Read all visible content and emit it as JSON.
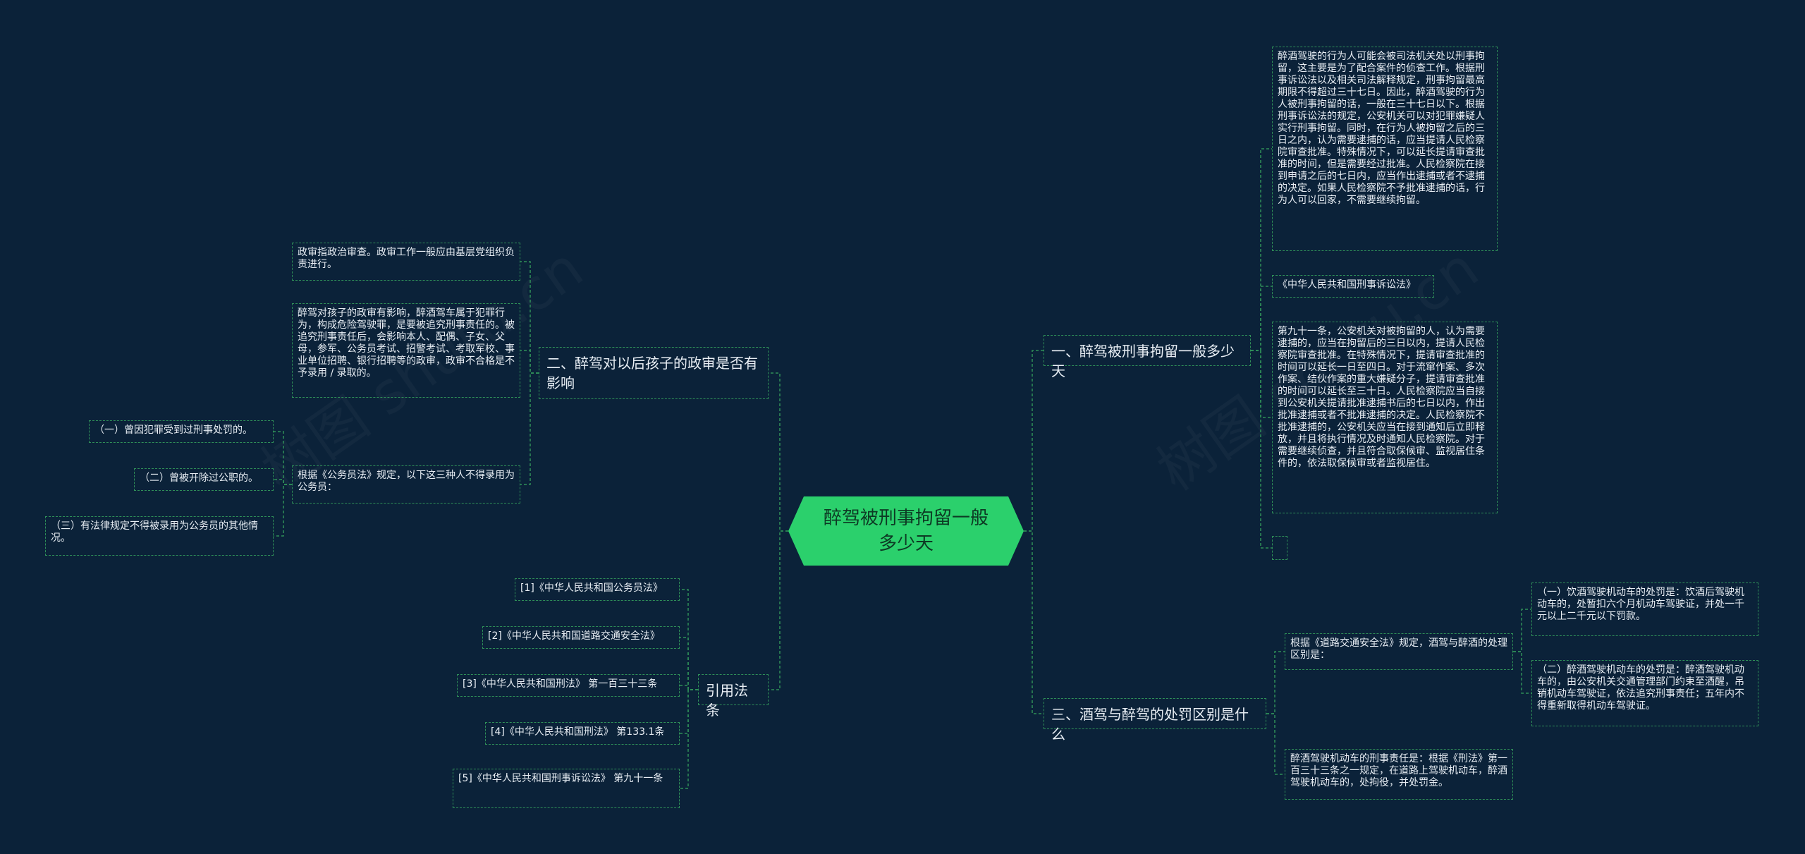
{
  "watermarks": [
    "树图 shutu.cn",
    "树图 shutu.cn"
  ],
  "root": "醉驾被刑事拘留一般多少天",
  "right": {
    "b1": {
      "title": "一、醉驾被刑事拘留一般多少天",
      "leaf1": "醉酒驾驶的行为人可能会被司法机关处以刑事拘留，这主要是为了配合案件的侦查工作。根据刑事诉讼法以及相关司法解释规定，刑事拘留最高期限不得超过三十七日。因此，醉酒驾驶的行为人被刑事拘留的话，一般在三十七日以下。根据刑事诉讼法的规定，公安机关可以对犯罪嫌疑人实行刑事拘留。同时，在行为人被拘留之后的三日之内，认为需要逮捕的话，应当提请人民检察院审查批准。特殊情况下，可以延长提请审查批准的时间，但是需要经过批准。人民检察院在接到申请之后的七日内，应当作出逮捕或者不逮捕的决定。如果人民检察院不予批准逮捕的话，行为人可以回家，不需要继续拘留。",
      "leaf2": "《中华人民共和国刑事诉讼法》",
      "leaf3": "第九十一条，公安机关对被拘留的人，认为需要逮捕的，应当在拘留后的三日以内，提请人民检察院审查批准。在特殊情况下，提请审查批准的时间可以延长一日至四日。对于流窜作案、多次作案、结伙作案的重大嫌疑分子，提请审查批准的时间可以延长至三十日。人民检察院应当自接到公安机关提请批准逮捕书后的七日以内，作出批准逮捕或者不批准逮捕的决定。人民检察院不批准逮捕的，公安机关应当在接到通知后立即释放，并且将执行情况及时通知人民检察院。对于需要继续侦查，并且符合取保候审、监视居住条件的，依法取保候审或者监视居住。",
      "leaf4": ""
    },
    "b3": {
      "title": "三、酒驾与醉驾的处罚区别是什么",
      "mid": "根据《道路交通安全法》规定，酒驾与醉酒的处理区别是：",
      "sub1": "（一）饮酒驾驶机动车的处罚是：饮酒后驾驶机动车的，处暂扣六个月机动车驾驶证，并处一千元以上二千元以下罚款。",
      "sub2": "（二）醉酒驾驶机动车的处罚是：醉酒驾驶机动车的，由公安机关交通管理部门约束至酒醒，吊销机动车驾驶证，依法追究刑事责任；五年内不得重新取得机动车驾驶证。",
      "leaf": "醉酒驾驶机动车的刑事责任是：根据《刑法》第一百三十三条之一规定，在道路上驾驶机动车，醉酒驾驶机动车的，处拘役，并处罚金。"
    }
  },
  "left": {
    "b2": {
      "title": "二、醉驾对以后孩子的政审是否有影响",
      "leaf1": "政审指政治审查。政审工作一般应由基层党组织负责进行。",
      "leaf2": "醉驾对孩子的政审有影响，醉酒驾车属于犯罪行为，构成危险驾驶罪，是要被追究刑事责任的。被追究刑事责任后，会影响本人、配偶、子女、父母，参军、公务员考试、招警考试、考取军校、事业单位招聘、银行招聘等的政审，政审不合格是不予录用 / 录取的。",
      "leaf3": "根据《公务员法》规定，以下这三种人不得录用为公务员：",
      "sub1": "（一）曾因犯罪受到过刑事处罚的。",
      "sub2": "（二）曾被开除过公职的。",
      "sub3": "（三）有法律规定不得被录用为公务员的其他情况。"
    },
    "b4": {
      "title": "引用法条",
      "refs": [
        "[1]《中华人民共和国公务员法》",
        "[2]《中华人民共和国道路交通安全法》",
        "[3]《中华人民共和国刑法》 第一百三十三条",
        "[4]《中华人民共和国刑法》 第133.1条",
        "[5]《中华人民共和国刑事诉讼法》 第九十一条"
      ]
    }
  },
  "colors": {
    "background": "#0b2239",
    "root": "#2bd06c",
    "line": "#2f8f58",
    "text": "#e8eef4"
  }
}
